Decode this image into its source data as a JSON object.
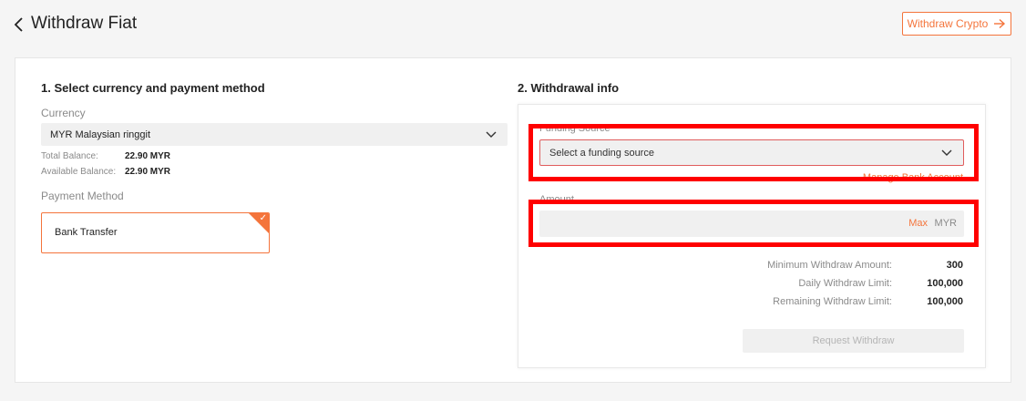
{
  "header": {
    "title": "Withdraw Fiat",
    "crypto_button_label": "Withdraw Crypto",
    "crypto_button_icon": "arrow-right-icon",
    "back_icon": "chevron-left-icon"
  },
  "section1": {
    "title": "1. Select currency and payment method",
    "currency_label": "Currency",
    "currency_value": "MYR Malaysian ringgit",
    "total_balance_label": "Total Balance:",
    "total_balance_value": "22.90 MYR",
    "available_balance_label": "Available Balance:",
    "available_balance_value": "22.90 MYR",
    "payment_method_label": "Payment Method",
    "payment_method_value": "Bank Transfer"
  },
  "section2": {
    "title": "2. Withdrawal info",
    "funding_source_label": "Funding Source",
    "funding_source_placeholder": "Select a funding source",
    "manage_bank_link": "Manage Bank Account",
    "amount_label": "Amount",
    "amount_value": "",
    "max_label": "Max",
    "unit": "MYR",
    "limits": [
      {
        "label": "Minimum Withdraw Amount:",
        "value": "300"
      },
      {
        "label": "Daily Withdraw Limit:",
        "value": "100,000"
      },
      {
        "label": "Remaining Withdraw Limit:",
        "value": "100,000"
      }
    ],
    "request_button_label": "Request Withdraw"
  },
  "colors": {
    "accent": "#f4743b",
    "highlight": "#ff0000",
    "background": "#f5f5f5",
    "input_bg": "#f0f0f0"
  }
}
